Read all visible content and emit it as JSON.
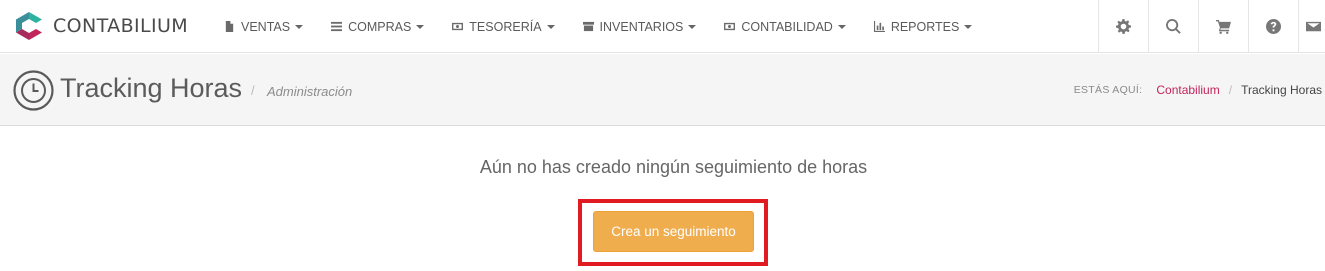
{
  "app": {
    "name": "CONTABILIUM"
  },
  "nav": {
    "items": [
      {
        "label": "VENTAS",
        "icon": "file-icon"
      },
      {
        "label": "COMPRAS",
        "icon": "list-icon"
      },
      {
        "label": "TESORERÍA",
        "icon": "money-icon"
      },
      {
        "label": "INVENTARIOS",
        "icon": "archive-icon"
      },
      {
        "label": "CONTABILIDAD",
        "icon": "money-icon"
      },
      {
        "label": "REPORTES",
        "icon": "bar-chart-icon"
      }
    ],
    "tools": [
      "gear-icon",
      "search-icon",
      "cart-icon",
      "help-icon",
      "mail-icon"
    ]
  },
  "header": {
    "title": "Tracking Horas",
    "subtitle": "Administración",
    "breadcrumb_label": "ESTÁS AQUÍ:",
    "breadcrumb_link": "Contabilium",
    "breadcrumb_current": "Tracking Horas"
  },
  "main": {
    "empty_message": "Aún no has creado ningún seguimiento de horas",
    "cta_label": "Crea un seguimiento"
  },
  "colors": {
    "accent": "#c2255c",
    "cta": "#f0ad4e",
    "highlight": "#e11b22",
    "logo_teal": "#2bb3a0",
    "logo_magenta": "#c2255c"
  }
}
